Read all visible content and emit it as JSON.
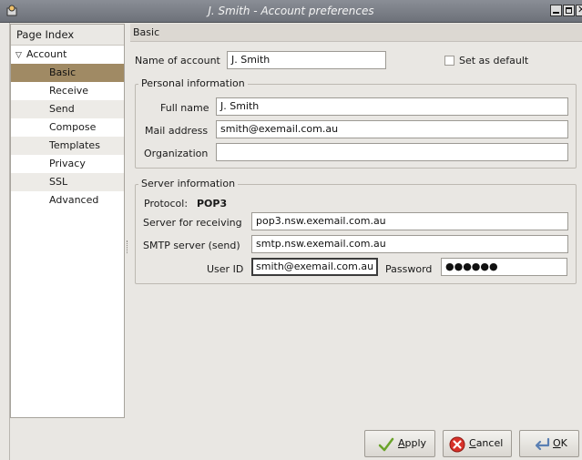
{
  "window": {
    "title": "J. Smith - Account preferences"
  },
  "sidebar": {
    "header": "Page Index",
    "root_label": "Account",
    "items": [
      {
        "label": "Basic",
        "selected": true
      },
      {
        "label": "Receive"
      },
      {
        "label": "Send"
      },
      {
        "label": "Compose"
      },
      {
        "label": "Templates"
      },
      {
        "label": "Privacy"
      },
      {
        "label": "SSL"
      },
      {
        "label": "Advanced"
      }
    ]
  },
  "main": {
    "section_title": "Basic",
    "account_name_label": "Name of account",
    "account_name_value": "J. Smith",
    "set_default_label": "Set as default",
    "personal": {
      "title": "Personal information",
      "full_name_label": "Full name",
      "full_name_value": "J. Smith",
      "mail_address_label": "Mail address",
      "mail_address_value": "smith@exemail.com.au",
      "organization_label": "Organization",
      "organization_value": ""
    },
    "server": {
      "title": "Server information",
      "protocol_label": "Protocol:",
      "protocol_value": "POP3",
      "receiving_label": "Server for receiving",
      "receiving_value": "pop3.nsw.exemail.com.au",
      "smtp_label": "SMTP server (send)",
      "smtp_value": "smtp.nsw.exemail.com.au",
      "user_id_label": "User ID",
      "user_id_value": "smith@exemail.com.au",
      "password_label": "Password",
      "password_value": "●●●●●●"
    }
  },
  "buttons": {
    "apply_first": "A",
    "apply_rest": "pply",
    "cancel_first": "C",
    "cancel_rest": "ancel",
    "ok_first": "O",
    "ok_rest": "K"
  },
  "colors": {
    "selected_item": "#a08a64",
    "titlebar": "#7a7e86"
  }
}
